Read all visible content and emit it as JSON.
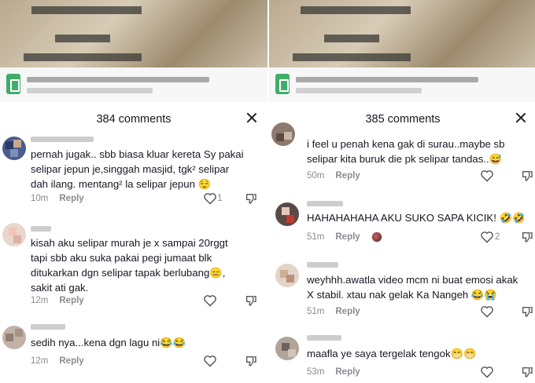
{
  "left": {
    "header_title": "384 comments",
    "comments": [
      {
        "text": "pernah jugak.. sbb biasa kluar kereta Sy pakai\nselipar jepun je,singgah masjid, tgk² selipar\ndah ilang. mentang² la selipar jepun 😌",
        "time": "10m",
        "reply": "Reply",
        "likes": "1"
      },
      {
        "text": "kisah aku selipar murah je x sampai 20rggt\ntapi sbb aku suka pakai pegi jumaat blk\nditukarkan dgn selipar tapak berlubang😑,\nsakit ati gak.",
        "time": "12m",
        "reply": "Reply",
        "likes": ""
      },
      {
        "text": "sedih nya...kena dgn lagu ni😂😂",
        "time": "12m",
        "reply": "Reply",
        "likes": ""
      }
    ]
  },
  "right": {
    "header_title": "385 comments",
    "comments": [
      {
        "text": "i feel u penah kena gak di surau..maybe sb\nselipar kita buruk die pk selipar tandas..😅",
        "time": "50m",
        "reply": "Reply",
        "likes": ""
      },
      {
        "text": "HAHAHAHAHA AKU SUKO SAPA KICIK! 🤣🤣",
        "time": "51m",
        "reply": "Reply",
        "likes": "2"
      },
      {
        "text": "weyhhh.awatla video mcm ni buat emosi akak\nX stabil. xtau nak gelak Ka Nangeh 😂😭",
        "time": "51m",
        "reply": "Reply",
        "likes": ""
      },
      {
        "text": "maafla ye saya tergelak tengok😁😁",
        "time": "53m",
        "reply": "Reply",
        "likes": ""
      }
    ]
  }
}
